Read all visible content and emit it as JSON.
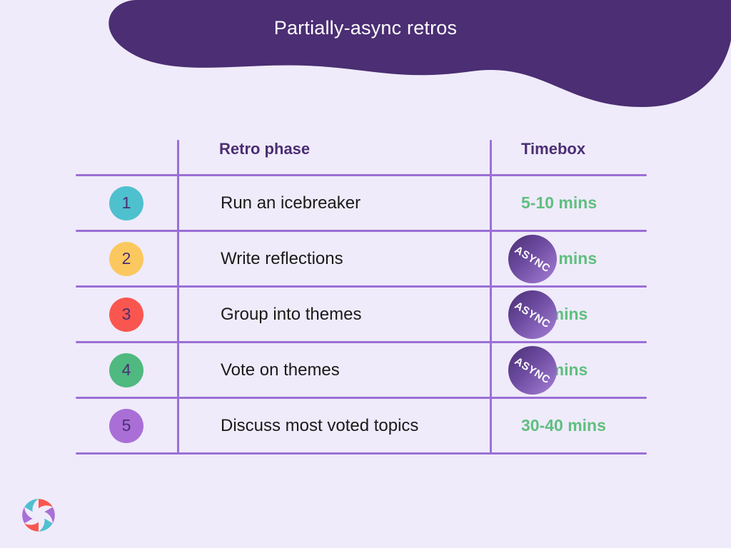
{
  "header": {
    "title": "Partially-async retros",
    "blob_color": "#4B2E73",
    "title_color": "#FFFFFF"
  },
  "theme": {
    "background": "#EFEBFA",
    "rule_color": "#9B6FD6",
    "header_text_color": "#4B2E73",
    "phase_text_color": "#1A1A1A",
    "timebox_text_color": "#5FBF7F",
    "badge_gradient_start": "#4B2E73",
    "badge_gradient_end": "#A77FD8"
  },
  "table": {
    "columns": {
      "number": "",
      "phase": "Retro phase",
      "timebox": "Timebox"
    },
    "rows": [
      {
        "number": "1",
        "number_color": "#4FC0CE",
        "phase": "Run an icebreaker",
        "timebox": "5-10 mins",
        "async": false,
        "async_label": ""
      },
      {
        "number": "2",
        "number_color": "#FBC85F",
        "phase": "Write reflections",
        "timebox": "5-10 mins",
        "async": true,
        "async_label": "ASYNC"
      },
      {
        "number": "3",
        "number_color": "#F9564F",
        "phase": "Group into themes",
        "timebox": "2-3 mins",
        "async": true,
        "async_label": "ASYNC"
      },
      {
        "number": "4",
        "number_color": "#4FB980",
        "phase": "Vote on themes",
        "timebox": "2-3 mins",
        "async": true,
        "async_label": "ASYNC"
      },
      {
        "number": "5",
        "number_color": "#A96FD6",
        "phase": "Discuss most voted topics",
        "timebox": "30-40 mins",
        "async": false,
        "async_label": ""
      }
    ]
  },
  "logo": {
    "name": "pinwheel-logo",
    "petal_colors": [
      "#F9564F",
      "#A96FD6",
      "#4FC0CE",
      "#F9564F",
      "#A96FD6",
      "#4FC0CE"
    ]
  }
}
